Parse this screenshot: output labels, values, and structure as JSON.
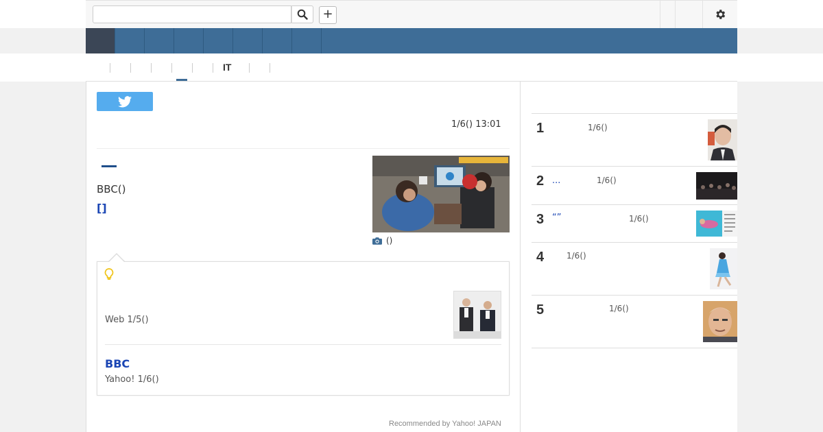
{
  "header": {
    "search_placeholder": "",
    "plus_label": "+"
  },
  "subnav": {
    "active_label": "IT"
  },
  "article": {
    "timestamp": "1/6() 13:01",
    "source_line": "BBC()",
    "bracket_link": "[]",
    "photo_caption": "()"
  },
  "related": {
    "item1_meta": "Web 1/5()",
    "item2_title": "BBC",
    "item2_meta": "Yahoo! 1/6()"
  },
  "footer": {
    "recommended": "Recommended by Yahoo! JAPAN"
  },
  "ranking": [
    {
      "num": "1",
      "title": "",
      "date": "1/6()"
    },
    {
      "num": "2",
      "title": "...",
      "date": "1/6()"
    },
    {
      "num": "3",
      "title": "“”",
      "date": "1/6()"
    },
    {
      "num": "4",
      "title": "",
      "date": "1/6()"
    },
    {
      "num": "5",
      "title": "",
      "date": "1/6()"
    }
  ],
  "colors": {
    "nav": "#3e6d97",
    "nav_active": "#3b4656",
    "link": "#1b46b4",
    "twitter": "#55acee",
    "bulb": "#f0c419"
  }
}
